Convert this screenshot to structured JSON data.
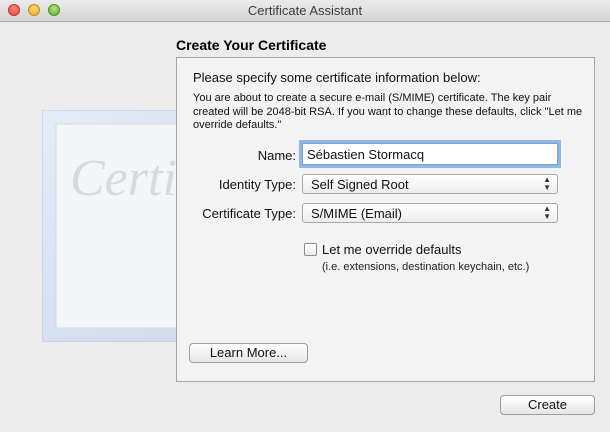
{
  "window": {
    "title": "Certificate Assistant"
  },
  "page": {
    "heading": "Create Your Certificate",
    "instruction": "Please specify some certificate information below:",
    "description": "You are about to create a secure e-mail (S/MIME) certificate. The key pair created will be 2048-bit RSA. If you want to change these defaults, click \"Let me override defaults.\""
  },
  "form": {
    "name_label": "Name:",
    "name_value": "Sébastien Stormacq",
    "identity_type_label": "Identity Type:",
    "identity_type_value": "Self Signed Root",
    "certificate_type_label": "Certificate Type:",
    "certificate_type_value": "S/MIME (Email)",
    "override_label": "Let me override defaults",
    "override_hint": "(i.e. extensions, destination keychain, etc.)",
    "override_checked": false
  },
  "buttons": {
    "learn_more": "Learn More...",
    "create": "Create"
  },
  "art": {
    "watermark_text": "Certificate"
  },
  "icons": {
    "select_arrows": "up-down-chevron-icon",
    "seal": "certificate-seal-icon"
  },
  "colors": {
    "focus_ring": "#6ca4e6",
    "window_bg": "#ececec",
    "cert_border": "#c8d8ea"
  }
}
